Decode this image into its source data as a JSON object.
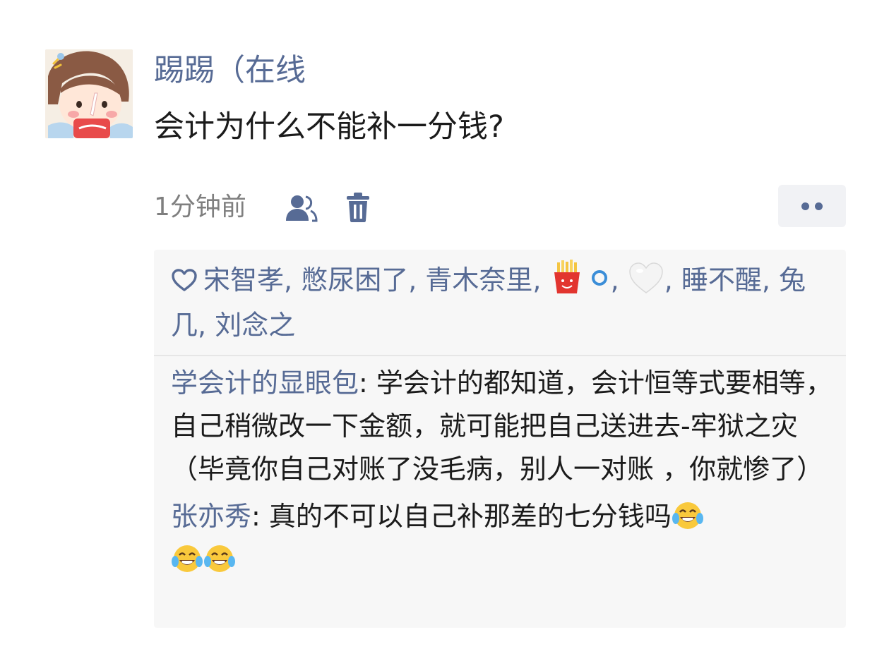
{
  "post": {
    "username": "踢踢（在线",
    "text": "会计为什么不能补一分钱?",
    "timestamp": "1分钟前"
  },
  "likes": {
    "names": [
      "宋智孝",
      "憋尿困了",
      "青木奈里"
    ],
    "emoji_user_1": "fries-emoji-and-circle",
    "emoji_user_2": "white-heart-emoji",
    "names_after": [
      "睡不醒",
      "兔几",
      "刘念之"
    ],
    "separator": ", "
  },
  "comments": [
    {
      "author": "学会计的显眼包",
      "colon": ": ",
      "text": "学会计的都知道，会计恒等式要相等，自己稍微改一下金额，就可能把自己送进去-牢狱之灾（毕竟你自己对账了没毛病，别人一对账 ，你就惨了）"
    },
    {
      "author": "张亦秀",
      "colon": ": ",
      "text": "真的不可以自己补那差的七分钱吗",
      "emojis": [
        "laughing-tears-emoji",
        "laughing-tears-emoji",
        "laughing-tears-emoji"
      ]
    }
  ],
  "colors": {
    "link_blue": "#576b95",
    "panel_bg": "#f7f7f7",
    "text": "#1b1b1b",
    "meta_gray": "#7f7f7f"
  }
}
